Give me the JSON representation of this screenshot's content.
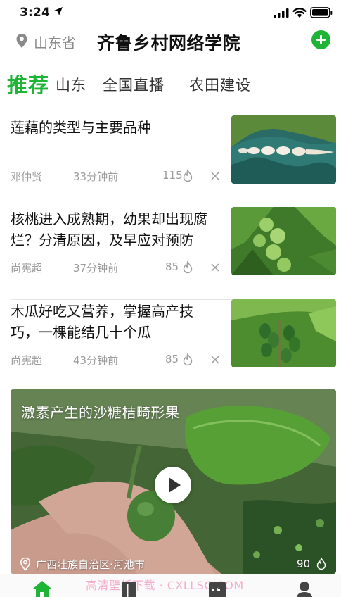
{
  "status_bar": {
    "time": "3:24"
  },
  "header": {
    "province": "山东省",
    "title": "齐鲁乡村网络学院",
    "add_icon": "plus-circle-icon",
    "accent_color": "#1eb536"
  },
  "tabs": [
    {
      "label": "推荐",
      "active": true
    },
    {
      "label": "山东",
      "active": false
    },
    {
      "label": "全国直播",
      "active": false
    },
    {
      "label": "农田建设",
      "active": false
    }
  ],
  "news": [
    {
      "title": "莲藕的类型与主要品种",
      "author": "邓仲贤",
      "time": "33分钟前",
      "views": "115"
    },
    {
      "title": "核桃进入成熟期，幼果却出现腐烂？分清原因，及早应对预防",
      "author": "尚宪超",
      "time": "37分钟前",
      "views": "85"
    },
    {
      "title": "木瓜好吃又营养，掌握高产技巧，一棵能结几十个瓜",
      "author": "尚宪超",
      "time": "43分钟前",
      "views": "85"
    }
  ],
  "video": {
    "title": "激素产生的沙糖桔畸形果",
    "location": "广西壮族自治区·河池市",
    "views": "90"
  },
  "watermark": "高清壁纸下载 · CXLLSC.COM"
}
